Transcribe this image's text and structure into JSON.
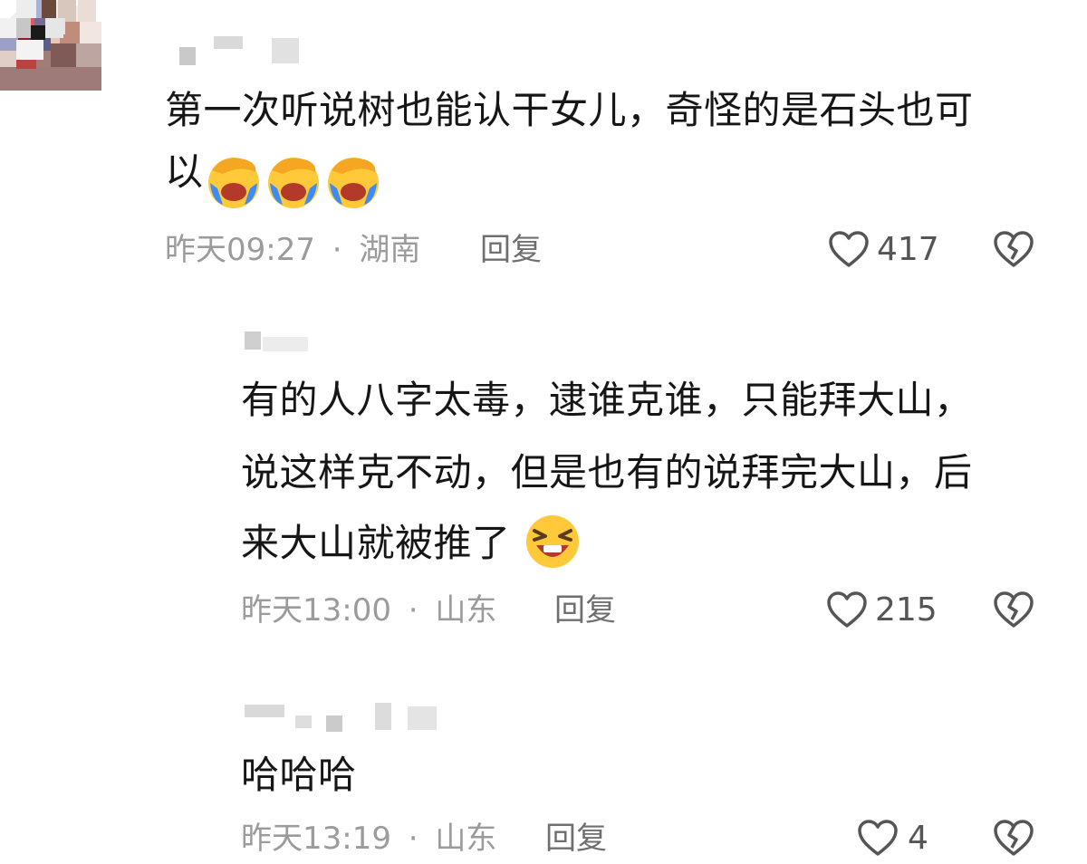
{
  "comments": [
    {
      "text_lines": [
        "第一次听说树也能认干女儿，奇怪的是石头也可",
        "以"
      ],
      "emoji": "facepalm-crying-emoji",
      "emoji_count": 3,
      "time": "昨天09:27",
      "location": "湖南",
      "reply_label": "回复",
      "likes": "417"
    },
    {
      "text_lines": [
        "有的人八字太毒，逮谁克谁，只能拜大山，",
        "说这样克不动，但是也有的说拜完大山，后",
        "来大山就被推了"
      ],
      "emoji": "laughing-squint-emoji",
      "emoji_count": 1,
      "time": "昨天13:00",
      "location": "山东",
      "reply_label": "回复",
      "likes": "215"
    },
    {
      "text_lines": [
        "哈哈哈"
      ],
      "time": "昨天13:19",
      "location": "山东",
      "reply_label": "回复",
      "likes": "4"
    }
  ],
  "separator": "·",
  "icons": {
    "like": "heart-outline-icon",
    "dislike": "broken-heart-icon"
  },
  "colors": {
    "text": "#161616",
    "meta": "#9b9b9b",
    "emoji_yellow": "#ffc93a",
    "emoji_blue": "#3d8cf5"
  }
}
